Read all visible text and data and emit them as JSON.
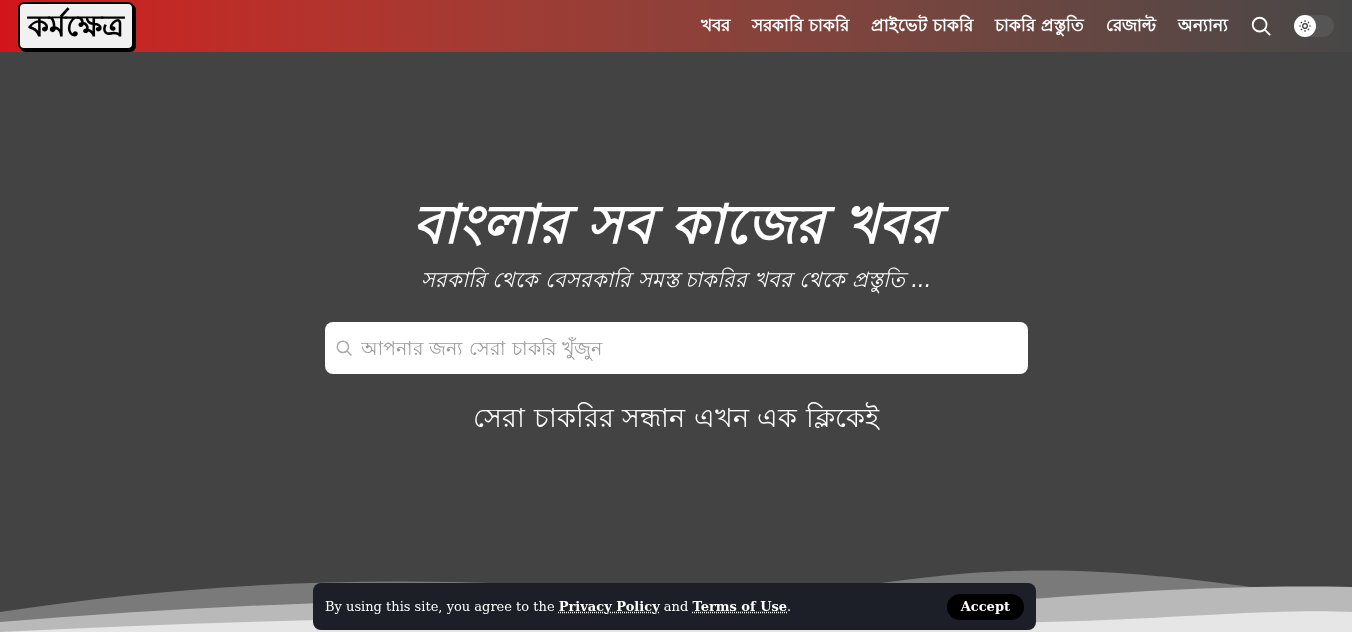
{
  "header": {
    "logo": "কর্মক্ষেত্র",
    "nav": [
      {
        "label": "খবর"
      },
      {
        "label": "সরকারি চাকরি"
      },
      {
        "label": "প্রাইভেট চাকরি"
      },
      {
        "label": "চাকরি প্রস্তুতি"
      },
      {
        "label": "রেজাল্ট"
      },
      {
        "label": "অন্যান্য"
      }
    ],
    "theme_toggle": {
      "on": false
    }
  },
  "hero": {
    "title": "বাংলার সব কাজের খবর",
    "subtitle": "সরকারি থেকে বেসরকারি সমস্ত চাকরির খবর থেকে প্রস্তুতি ...",
    "search": {
      "placeholder": "আপনার জন্য সেরা চাকরি খুঁজুন"
    },
    "tagline": "সেরা চাকরির সন্ধান এখন এক ক্লিকেই"
  },
  "consent": {
    "segments": [
      {
        "kind": "text",
        "text": "By using this site, you agree to the"
      },
      {
        "kind": "link",
        "text": "Privacy Policy"
      },
      {
        "kind": "text",
        "text": "and"
      },
      {
        "kind": "link",
        "text": "Terms of Use"
      },
      {
        "kind": "text",
        "text": "."
      }
    ],
    "button": "Accept"
  }
}
